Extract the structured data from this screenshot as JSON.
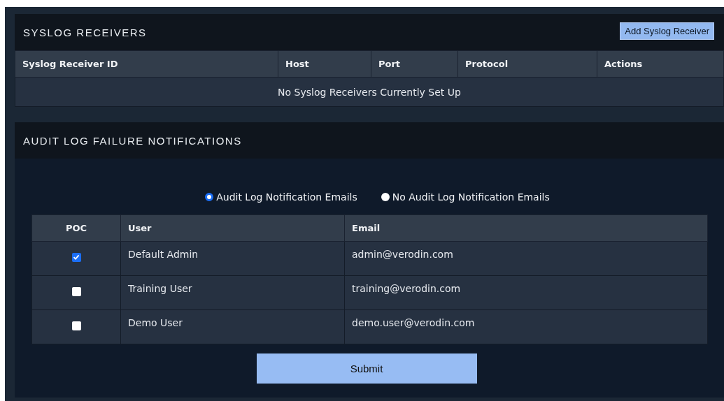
{
  "syslog_receivers": {
    "title": "SYSLOG RECEIVERS",
    "add_button": "Add Syslog Receiver",
    "table": {
      "columns": [
        "Syslog Receiver ID",
        "Host",
        "Port",
        "Protocol",
        "Actions"
      ],
      "empty_message": "No Syslog Receivers Currently Set Up"
    }
  },
  "audit_log_failure_notifications": {
    "title": "AUDIT LOG FAILURE NOTIFICATIONS",
    "options": [
      {
        "label": "Audit Log Notification Emails",
        "selected": true
      },
      {
        "label": "No Audit Log Notification Emails",
        "selected": false
      }
    ],
    "table": {
      "columns": [
        "POC",
        "User",
        "Email"
      ],
      "rows": [
        {
          "poc_checked": true,
          "user": "Default Admin",
          "email": "admin@verodin.com"
        },
        {
          "poc_checked": false,
          "user": "Training User",
          "email": "training@verodin.com"
        },
        {
          "poc_checked": false,
          "user": "Demo User",
          "email": "demo.user@verodin.com"
        }
      ]
    },
    "submit_button": "Submit"
  }
}
